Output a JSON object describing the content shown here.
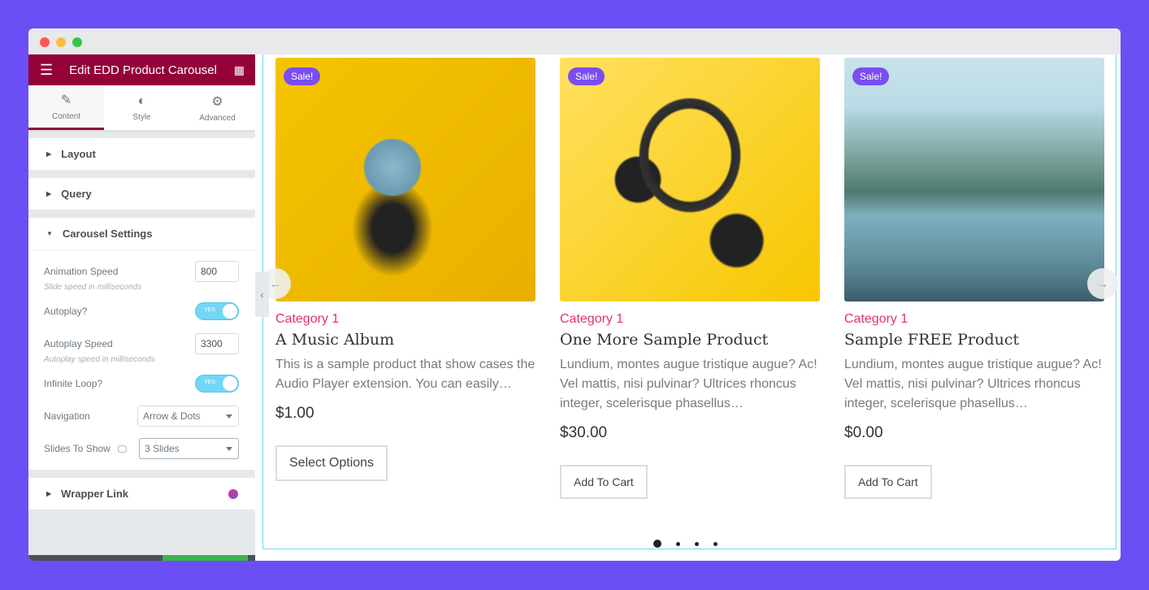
{
  "window": {
    "controls": [
      "close",
      "minimize",
      "maximize"
    ]
  },
  "panel": {
    "title": "Edit EDD Product Carousel",
    "tabs": [
      {
        "label": "Content",
        "icon": "pencil-icon"
      },
      {
        "label": "Style",
        "icon": "contrast-icon"
      },
      {
        "label": "Advanced",
        "icon": "gear-icon"
      }
    ],
    "sections": {
      "layout": "Layout",
      "query": "Query",
      "carousel": "Carousel Settings",
      "wrapper": "Wrapper Link"
    },
    "fields": {
      "animation_speed": {
        "label": "Animation Speed",
        "value": "800",
        "hint": "Slide speed in milliseconds"
      },
      "autoplay": {
        "label": "Autoplay?",
        "value": "YES"
      },
      "autoplay_speed": {
        "label": "Autoplay Speed",
        "value": "3300",
        "hint": "Autoplay speed in milliseconds"
      },
      "infinite_loop": {
        "label": "Infinite Loop?",
        "value": "YES"
      },
      "navigation": {
        "label": "Navigation",
        "value": "Arrow & Dots"
      },
      "slides_to_show": {
        "label": "Slides To Show",
        "value": "3 Slides"
      }
    }
  },
  "products": [
    {
      "badge": "Sale!",
      "category": "Category 1",
      "name": "A Music Album",
      "desc": "This is a sample product that show cases the Audio Player extension. You can easily…",
      "price": "$1.00",
      "button": "Select Options"
    },
    {
      "badge": "Sale!",
      "category": "Category 1",
      "name": "One More Sample Product",
      "desc": "Lundium, montes augue tristique augue? Ac! Vel mattis, nisi pulvinar? Ultrices rhoncus integer, scelerisque phasellus…",
      "price": "$30.00",
      "button": "Add To Cart"
    },
    {
      "badge": "Sale!",
      "category": "Category 1",
      "name": "Sample FREE Product",
      "desc": "Lundium, montes augue tristique augue? Ac! Vel mattis, nisi pulvinar? Ultrices rhoncus integer, scelerisque phasellus…",
      "price": "$0.00",
      "button": "Add To Cart"
    }
  ],
  "carousel": {
    "dots": 4,
    "active_dot": 1
  },
  "colors": {
    "brand": "#93003a",
    "category": "#e2336a",
    "badge": "#7a4df3",
    "toggle": "#71d7f7",
    "background": "#6c4ff4"
  }
}
